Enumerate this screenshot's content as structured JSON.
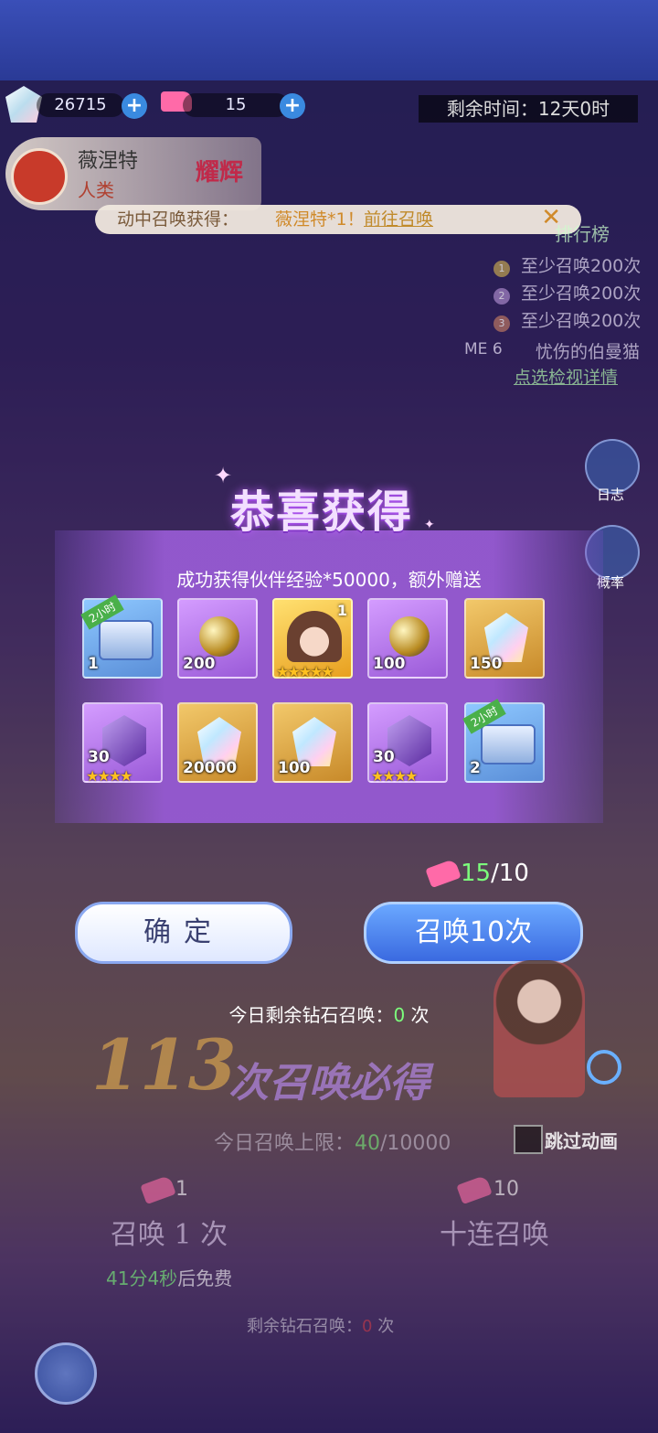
{
  "top": {
    "diamonds": "26715",
    "tickets": "15",
    "timer": "剩余时间：12天0时"
  },
  "character": {
    "name": "薇涅特",
    "race": "人类",
    "badge": "耀辉"
  },
  "notice": {
    "prefix": "动中召唤获得：",
    "highlight": "薇涅特*1",
    "exclaim": "！",
    "link": "前往召唤",
    "close": "✕"
  },
  "ranking": {
    "title": "排行榜",
    "rows": [
      {
        "rank": "1",
        "text": "至少召唤200次"
      },
      {
        "rank": "2",
        "text": "至少召唤200次"
      },
      {
        "rank": "3",
        "text": "至少召唤200次"
      }
    ],
    "me_label": "ME",
    "me_rank": "6",
    "me_name": "忧伤的伯曼猫",
    "detail_link": "点选检视详情"
  },
  "side": {
    "log": "日志",
    "rate": "概率"
  },
  "reward": {
    "title": "恭喜获得",
    "subtitle": "成功获得伙伴经验*50000，额外赠送",
    "items": [
      {
        "kind": "chest",
        "rarity": "blue",
        "count": "1",
        "tag": "2小时"
      },
      {
        "kind": "egg",
        "rarity": "purple",
        "count": "200"
      },
      {
        "kind": "hero",
        "rarity": "hero",
        "count": "1",
        "stars": "★★★★★"
      },
      {
        "kind": "egg",
        "rarity": "purple",
        "count": "100"
      },
      {
        "kind": "crystal",
        "rarity": "gold",
        "count": "150"
      },
      {
        "kind": "purple-gem",
        "rarity": "purple",
        "count": "30",
        "stars": "★★★★"
      },
      {
        "kind": "crystal",
        "rarity": "gold",
        "count": "20000"
      },
      {
        "kind": "crystal",
        "rarity": "gold",
        "count": "100"
      },
      {
        "kind": "purple-gem",
        "rarity": "purple",
        "count": "30",
        "stars": "★★★★"
      },
      {
        "kind": "chest",
        "rarity": "blue",
        "count": "2",
        "tag": "2小时"
      }
    ]
  },
  "cost": {
    "have": "15",
    "need": "/10"
  },
  "buttons": {
    "confirm": "确定",
    "summon10": "召唤10次"
  },
  "daily": {
    "label": "今日剩余钻石召唤：",
    "value": "0",
    "unit": "次"
  },
  "pity": {
    "number": "113",
    "text": "次召唤必得"
  },
  "limit": {
    "label": "今日召唤上限：",
    "used": "40",
    "max": "/10000"
  },
  "skip": "跳过动画",
  "bottom": {
    "single_cost": "1",
    "ten_cost": "10",
    "single": "召唤 1 次",
    "ten": "十连召唤",
    "free_time": "41分4秒",
    "free_suffix": "后免费",
    "remain_label": "剩余钻石召唤：",
    "remain_value": "0",
    "remain_unit": "次"
  }
}
